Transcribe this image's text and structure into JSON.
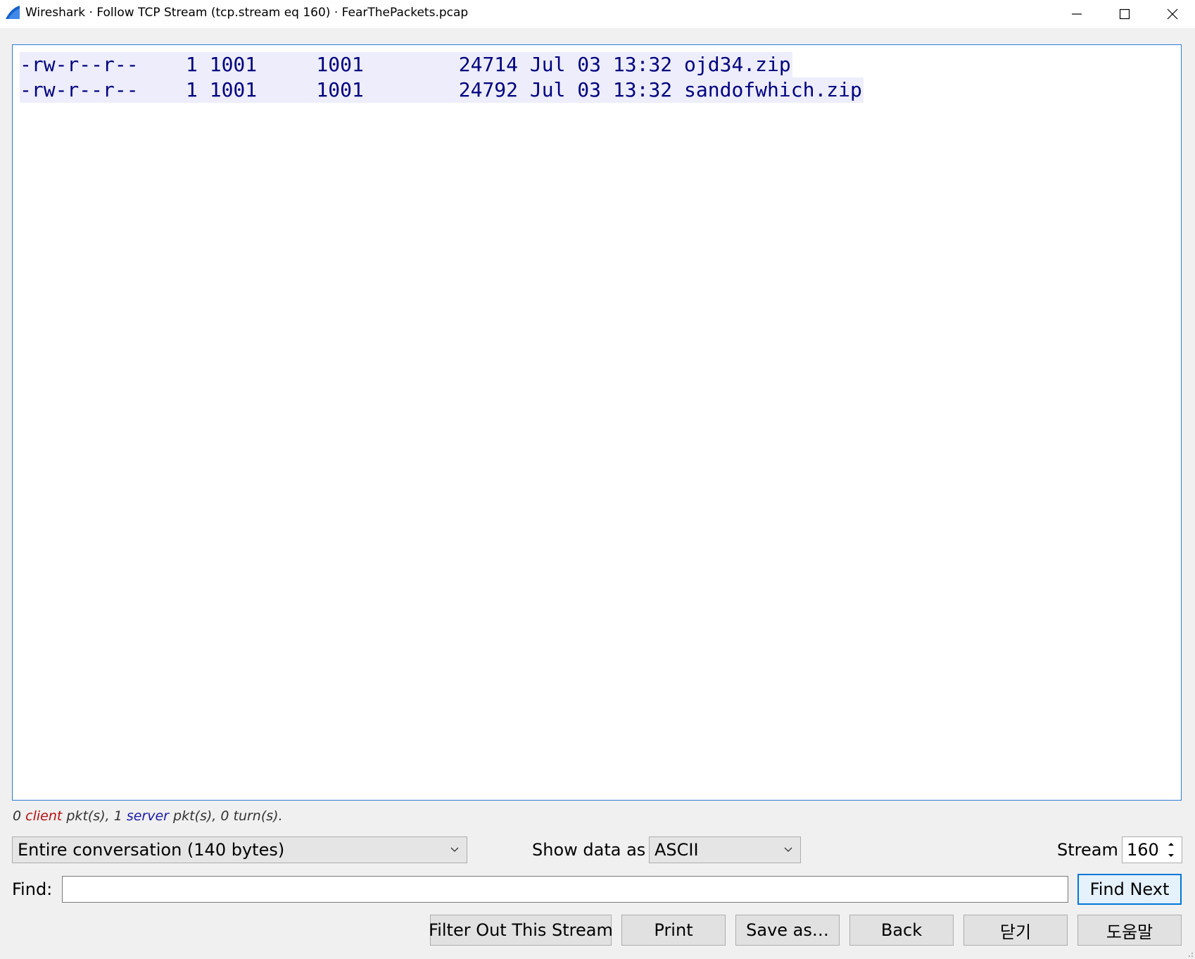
{
  "window": {
    "title": "Wireshark · Follow TCP Stream (tcp.stream eq 160) · FearThePackets.pcap",
    "app_icon": "wireshark-fin-icon",
    "controls": [
      "minimize-icon",
      "maximize-icon",
      "close-icon"
    ]
  },
  "stream": {
    "lines": [
      "-rw-r--r--    1 1001     1001        24714 Jul 03 13:32 ojd34.zip",
      "-rw-r--r--    1 1001     1001        24792 Jul 03 13:32 sandofwhich.zip"
    ],
    "server_text_color": "#00007f",
    "server_bg_color": "#ededfb"
  },
  "stats": {
    "client_count": "0",
    "client_word": "client",
    "pkt_suffix_1": "pkt(s),",
    "server_count": "1",
    "server_word": "server",
    "pkt_suffix_2": "pkt(s),",
    "turns": "0 turn(s)."
  },
  "controls": {
    "conversation_select": "Entire conversation (140 bytes)",
    "show_data_label": "Show data as",
    "show_data_select": "ASCII",
    "stream_label": "Stream",
    "stream_value": "160",
    "find_label": "Find:",
    "find_value": "",
    "find_next": "Find Next"
  },
  "buttons": {
    "filter_out": "Filter Out This Stream",
    "print": "Print",
    "save_as": "Save as…",
    "back": "Back",
    "close": "닫기",
    "help": "도움말"
  },
  "colors": {
    "accent": "#0078d7",
    "client": "#b51010",
    "server": "#1a1aa8"
  }
}
